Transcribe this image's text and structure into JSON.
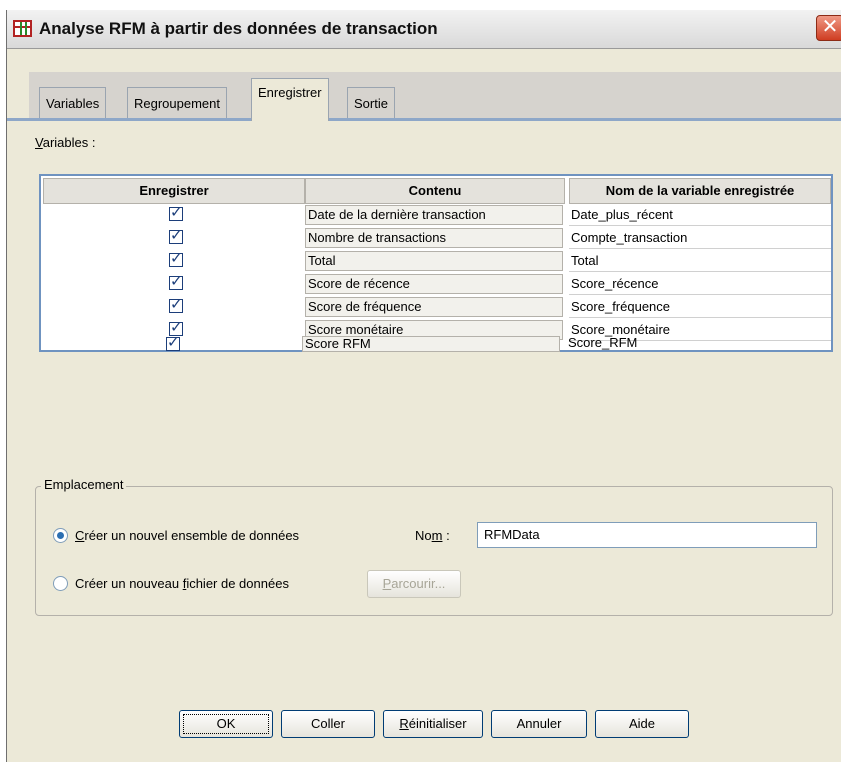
{
  "window": {
    "title": "Analyse RFM à partir des données de transaction",
    "close_glyph": "✕"
  },
  "tabs": [
    {
      "label": "Variables"
    },
    {
      "label": "Regroupement"
    },
    {
      "label": "Enregistrer",
      "active": true
    },
    {
      "label": "Sortie"
    }
  ],
  "variables_section": {
    "label_first": "V",
    "label_rest": "ariables :",
    "columns": [
      "Enregistrer",
      "Contenu",
      "Nom de la variable enregistrée"
    ],
    "rows": [
      {
        "save": true,
        "content": "Date de la dernière transaction",
        "name": "Date_plus_récent"
      },
      {
        "save": true,
        "content": "Nombre de transactions",
        "name": "Compte_transaction"
      },
      {
        "save": true,
        "content": "Total",
        "name": "Total"
      },
      {
        "save": true,
        "content": "Score de récence",
        "name": "Score_récence"
      },
      {
        "save": true,
        "content": "Score de fréquence",
        "name": "Score_fréquence"
      },
      {
        "save": true,
        "content": "Score monétaire",
        "name": "Score_monétaire"
      },
      {
        "save": true,
        "content": "Score RFM",
        "name": "Score_RFM"
      }
    ]
  },
  "emplacement": {
    "legend": "Emplacement",
    "option_new_dataset_first": "C",
    "option_new_dataset_rest": "réer un nouvel ensemble de données",
    "option_new_file_a": "Créer un nouveau ",
    "option_new_file_u": "f",
    "option_new_file_b": "ichier de données",
    "name_label_a": "No",
    "name_label_u": "m",
    "name_label_b": " :",
    "name_value": "RFMData",
    "browse_first": "P",
    "browse_rest": "arcourir..."
  },
  "buttons": {
    "ok": "OK",
    "paste": "Coller",
    "reset_first": "R",
    "reset_rest": "éinitialiser",
    "cancel": "Annuler",
    "help": "Aide"
  },
  "colors": {
    "accent_tab_line": "#8ea7c8",
    "table_border": "#6f93c0",
    "close": "#cf3d22"
  }
}
